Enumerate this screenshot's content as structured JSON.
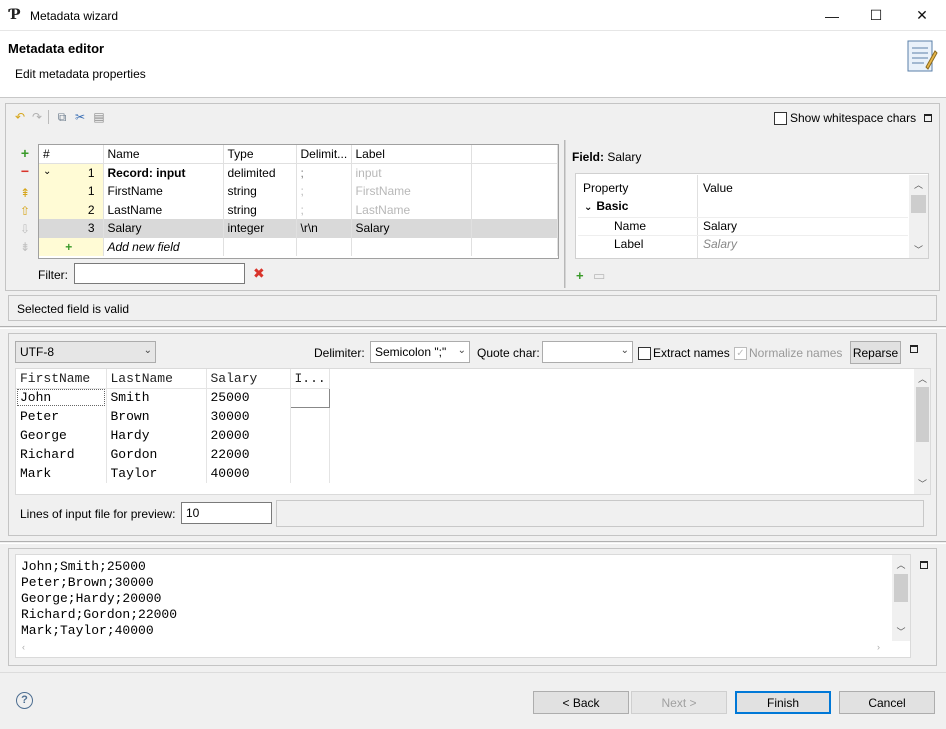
{
  "window": {
    "title": "Metadata wizard",
    "buttons": {
      "minimize": "—",
      "maximize": "☐",
      "close": "✕"
    }
  },
  "header": {
    "title": "Metadata editor",
    "subtitle": "Edit metadata properties"
  },
  "toolbar": {
    "show_whitespace_label": "Show whitespace chars"
  },
  "fields_table": {
    "columns": [
      "#",
      "Name",
      "Type",
      "Delimit...",
      "Label"
    ],
    "record": {
      "num": "1",
      "name": "Record: input",
      "type": "delimited",
      "delimiter": ";",
      "label": "input"
    },
    "rows": [
      {
        "num": "1",
        "name": "FirstName",
        "type": "string",
        "delimiter": ";",
        "label": "FirstName"
      },
      {
        "num": "2",
        "name": "LastName",
        "type": "string",
        "delimiter": ";",
        "label": "LastName"
      },
      {
        "num": "3",
        "name": "Salary",
        "type": "integer",
        "delimiter": "\\r\\n",
        "label": "Salary"
      }
    ],
    "add_new_field": "Add new field",
    "filter_label": "Filter:"
  },
  "field_panel": {
    "title_prefix": "Field:",
    "title_value": "Salary",
    "columns": [
      "Property",
      "Value"
    ],
    "section": "Basic",
    "props": [
      {
        "name": "Name",
        "value": "Salary"
      },
      {
        "name": "Label",
        "value": "Salary"
      }
    ]
  },
  "status": {
    "message": "Selected field is valid"
  },
  "preview_controls": {
    "encoding": "UTF-8",
    "delimiter_label": "Delimiter:",
    "delimiter_value": "Semicolon \";\"",
    "quote_label": "Quote char:",
    "quote_value": "",
    "extract_names_label": "Extract names",
    "normalize_names_label": "Normalize names",
    "reparse_label": "Reparse"
  },
  "preview_table": {
    "columns": [
      "FirstName",
      "LastName",
      "Salary",
      "I..."
    ],
    "rows": [
      [
        "John",
        "Smith",
        "25000"
      ],
      [
        "Peter",
        "Brown",
        "30000"
      ],
      [
        "George",
        "Hardy",
        "20000"
      ],
      [
        "Richard",
        "Gordon",
        "22000"
      ],
      [
        "Mark",
        "Taylor",
        "40000"
      ]
    ],
    "lines_label": "Lines of input file for preview:",
    "lines_value": "10"
  },
  "raw_text": {
    "lines": [
      "John;Smith;25000",
      "Peter;Brown;30000",
      "George;Hardy;20000",
      "Richard;Gordon;22000",
      "Mark;Taylor;40000"
    ]
  },
  "footer": {
    "help": "?",
    "back": "< Back",
    "next": "Next >",
    "finish": "Finish",
    "cancel": "Cancel"
  },
  "colors": {
    "accent": "#0078d7",
    "selected_row": "#d9d9d9",
    "number_cell": "#fffbd5",
    "remove_icon": "#d9342b",
    "add_icon": "#3a9a2a"
  }
}
